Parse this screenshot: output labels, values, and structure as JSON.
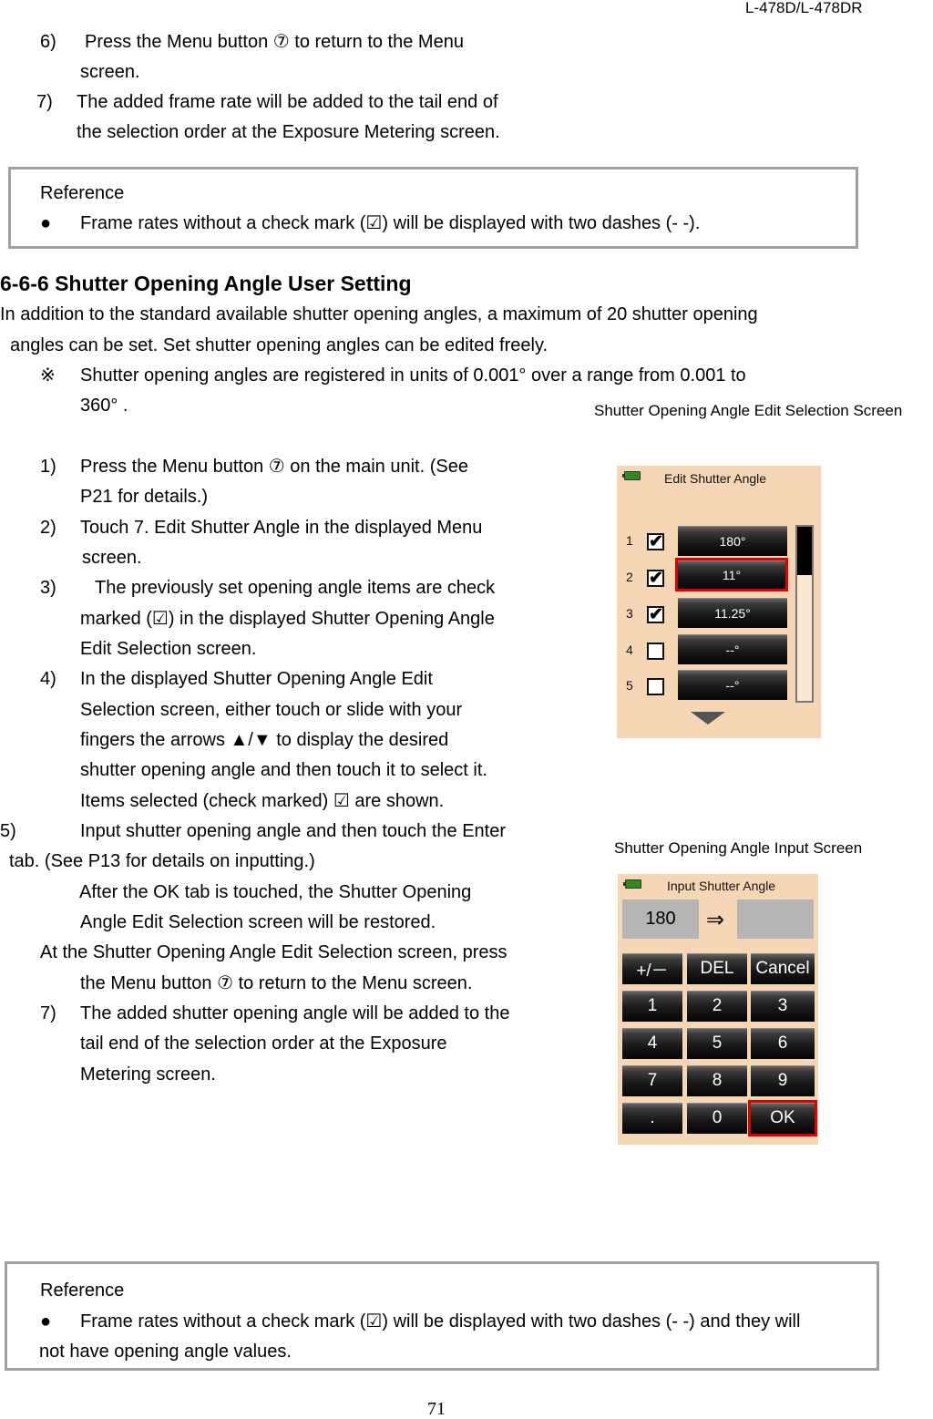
{
  "header": {
    "model": "L-478D/L-478DR"
  },
  "top_steps": [
    {
      "num": "6)",
      "line1": "Press the Menu button ⑦ to return to the Menu",
      "line2": "screen."
    },
    {
      "num": "7)",
      "line1": "The added frame rate will be added to the tail end of",
      "line2": "the selection order at the Exposure Metering screen."
    }
  ],
  "reference_top": {
    "title": "Reference",
    "bullet": "●",
    "text": "Frame rates without a check mark (☑) will be displayed with two dashes (- -)."
  },
  "section": {
    "title": "6-6-6 Shutter Opening Angle User Setting",
    "intro_line1": "In addition to the standard available shutter opening angles, a maximum of 20 shutter opening",
    "intro_line2": "angles can be set. Set shutter opening angles can be edited freely.",
    "note_mark": "※",
    "note_line1": "Shutter opening angles are registered in units of 0.001°  over a range from 0.001 to",
    "note_line2": "360°  ."
  },
  "steps": [
    {
      "num": "1)",
      "lines": [
        "Press the Menu button ⑦ on the main unit. (See",
        "P21 for details.)"
      ]
    },
    {
      "num": "2)",
      "lines": [
        "Touch 7. Edit Shutter Angle in the displayed Menu",
        "screen."
      ]
    },
    {
      "num": "3)",
      "lines": [
        "The previously set opening angle items are check",
        "marked (☑) in the displayed Shutter Opening Angle",
        "Edit Selection screen."
      ]
    },
    {
      "num": "4)",
      "lines": [
        "In the displayed Shutter Opening Angle Edit",
        "Selection screen, either touch or slide with your",
        "fingers the arrows  ▲/▼  to display the desired",
        "shutter opening angle and then touch it to select it.",
        "Items selected (check marked)  ☑  are shown."
      ]
    },
    {
      "num": "5)",
      "lines": [
        "Input shutter opening angle and then touch the Enter",
        "tab. (See P13 for details on inputting.)",
        "After the OK tab is touched, the Shutter Opening",
        "Angle Edit Selection screen will be restored."
      ]
    },
    {
      "num": "",
      "lines": [
        "At the Shutter Opening Angle Edit Selection screen, press",
        "the Menu button ⑦ to return to the Menu screen."
      ]
    },
    {
      "num": "7)",
      "lines": [
        "The added shutter opening angle will be added to the",
        "tail end of the selection order at the Exposure",
        "Metering screen."
      ]
    }
  ],
  "edit_screen": {
    "caption": "Shutter Opening Angle Edit Selection Screen",
    "title": "Edit Shutter Angle",
    "battery_icon": "battery-icon",
    "rows": [
      {
        "num": "1",
        "checked": true,
        "value": "180°",
        "selected": false
      },
      {
        "num": "2",
        "checked": true,
        "value": "11°",
        "selected": true
      },
      {
        "num": "3",
        "checked": true,
        "value": "11.25°",
        "selected": false
      },
      {
        "num": "4",
        "checked": false,
        "value": "--°",
        "selected": false
      },
      {
        "num": "5",
        "checked": false,
        "value": "--°",
        "selected": false
      }
    ],
    "check_glyph": "✔",
    "scroll_fraction": 0.28,
    "highlight_color": "#e00000"
  },
  "input_screen": {
    "caption": "Shutter Opening Angle Input Screen",
    "title": "Input Shutter Angle",
    "current_value": "180",
    "arrow": "⇒",
    "new_value": "",
    "keys": [
      [
        "+/－",
        "DEL",
        "Cancel"
      ],
      [
        "1",
        "2",
        "3"
      ],
      [
        "4",
        "5",
        "6"
      ],
      [
        "7",
        "8",
        "9"
      ],
      [
        ".",
        "0",
        "OK"
      ]
    ],
    "highlighted_key": "OK"
  },
  "reference_bottom": {
    "title": "Reference",
    "bullet": "●",
    "line1": "Frame rates without a check mark (☑) will be displayed with two dashes (- -) and they will",
    "line2": "not have opening angle values."
  },
  "footer": {
    "page_number": "71"
  }
}
